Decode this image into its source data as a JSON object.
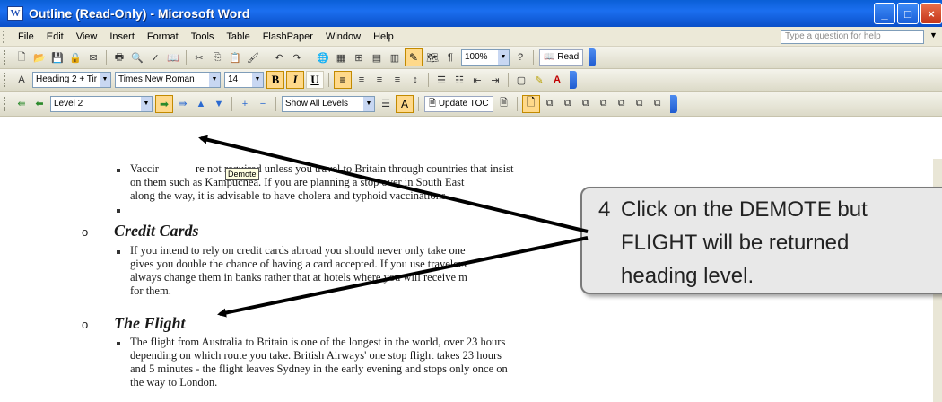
{
  "window": {
    "title": "Outline (Read-Only) - Microsoft Word",
    "app_icon": "word-icon",
    "controls": [
      "_",
      "□",
      "×"
    ]
  },
  "menubar": {
    "items": [
      "File",
      "Edit",
      "View",
      "Insert",
      "Format",
      "Tools",
      "Table",
      "FlashPaper",
      "Window",
      "Help"
    ],
    "help_placeholder": "Type a question for help"
  },
  "standard_toolbar": {
    "zoom": "100%",
    "read_label": "Read"
  },
  "formatting_toolbar": {
    "style": "Heading 2 + Tir",
    "font": "Times New Roman",
    "size": "14"
  },
  "outlining_toolbar": {
    "level": "Level 2",
    "show_level": "Show All Levels",
    "update_toc": "Update TOC"
  },
  "tooltip": {
    "text": "Demote"
  },
  "document": {
    "para1": [
      "Vaccir",
      "re not required unless you travel to Britain through countries that insist",
      "on them such as Kampuchea. If you are planning a stop over in South East",
      "along the way, it is advisable to have cholera and typhoid vaccinations."
    ],
    "heading1": "Credit Cards",
    "para2": [
      "If you intend to rely on credit cards abroad you should never only take one",
      "gives you double the chance of having a card accepted.  If you use travelers",
      "always change them in banks rather that at hotels where you will receive m",
      "for them."
    ],
    "heading2": "The Flight",
    "para3": [
      "The flight from Australia to Britain is one of the longest in the world, over 23 hours",
      "depending on which route you take.  British Airways' one stop flight takes 23 hours",
      "and 5 minutes - the flight leaves Sydney in the early evening and stops only once on",
      "the way to London."
    ]
  },
  "callout": {
    "number": "4",
    "lines": [
      "Click on the DEMOTE but",
      "FLIGHT will be returned",
      "heading level."
    ]
  }
}
